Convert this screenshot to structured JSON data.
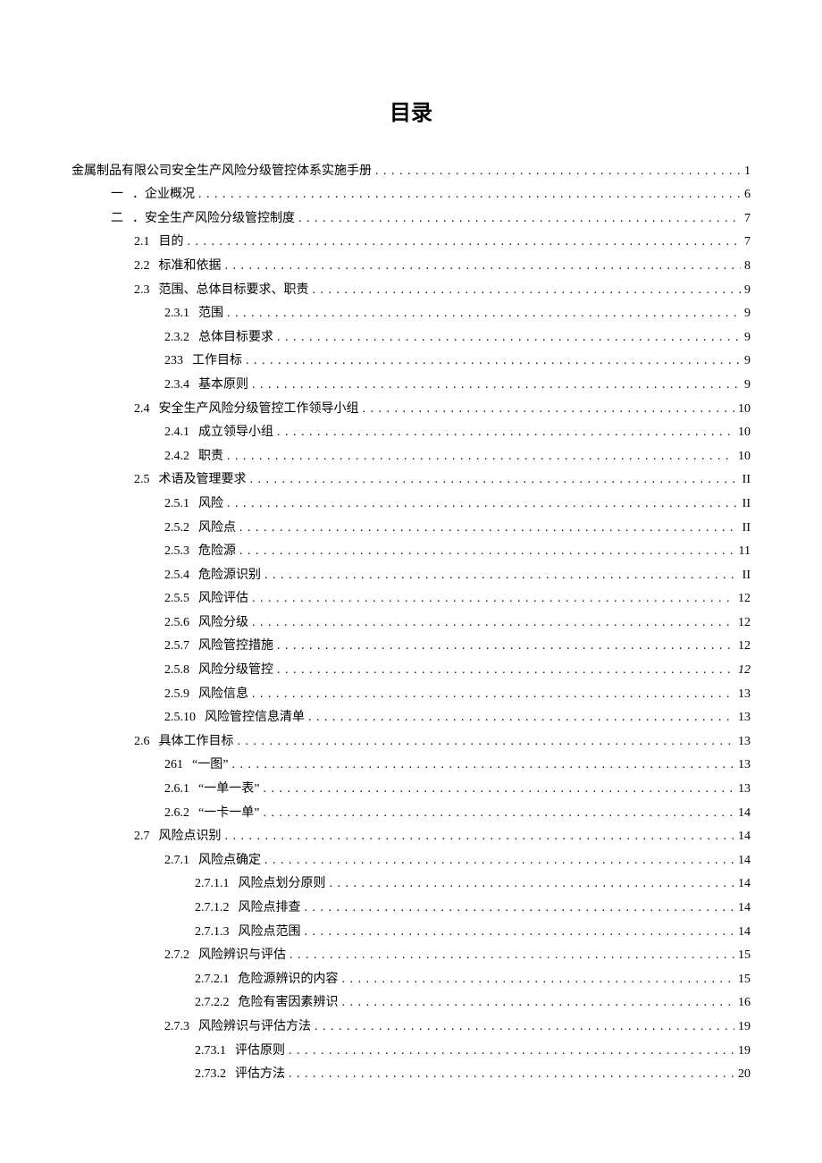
{
  "title": "目录",
  "entries": [
    {
      "level": 0,
      "num": "",
      "label": "金属制品有限公司安全生产风险分级管控体系实施手册",
      "page": "1"
    },
    {
      "level": 1,
      "num": "一",
      "label": "．企业概况",
      "page": "6"
    },
    {
      "level": 1,
      "num": "二",
      "label": "．安全生产风险分级管控制度",
      "page": "7"
    },
    {
      "level": 2,
      "num": "2.1",
      "label": "目的",
      "page": "7"
    },
    {
      "level": 2,
      "num": "2.2",
      "label": "标准和依据",
      "page": "8"
    },
    {
      "level": 2,
      "num": "2.3",
      "label": "范围、总体目标要求、职责",
      "page": "9"
    },
    {
      "level": 3,
      "num": "2.3.1",
      "label": "范围",
      "page": "9"
    },
    {
      "level": 3,
      "num": "2.3.2",
      "label": "总体目标要求",
      "page": "9"
    },
    {
      "level": 3,
      "num": "233",
      "label": "工作目标",
      "page": "9"
    },
    {
      "level": 3,
      "num": "2.3.4",
      "label": "基本原则",
      "page": "9"
    },
    {
      "level": 2,
      "num": "2.4",
      "label": "安全生产风险分级管控工作领导小组",
      "page": "10"
    },
    {
      "level": 3,
      "num": "2.4.1",
      "label": "成立领导小组",
      "page": "10"
    },
    {
      "level": 3,
      "num": "2.4.2",
      "label": "职责",
      "page": "10"
    },
    {
      "level": 2,
      "num": "2.5",
      "label": "术语及管理要求",
      "page": "II"
    },
    {
      "level": 3,
      "num": "2.5.1",
      "label": "风险",
      "page": "II"
    },
    {
      "level": 3,
      "num": "2.5.2",
      "label": "风险点",
      "page": "II"
    },
    {
      "level": 3,
      "num": "2.5.3",
      "label": "危险源",
      "page": "11"
    },
    {
      "level": 3,
      "num": "2.5.4",
      "label": "危险源识别",
      "page": "II"
    },
    {
      "level": 3,
      "num": "2.5.5",
      "label": "风险评估",
      "page": "12"
    },
    {
      "level": 3,
      "num": "2.5.6",
      "label": "风险分级",
      "page": "12"
    },
    {
      "level": 3,
      "num": "2.5.7",
      "label": "风险管控措施",
      "page": "12"
    },
    {
      "level": 3,
      "num": "2.5.8",
      "label": "风险分级管控",
      "page": "12",
      "italic": true
    },
    {
      "level": 3,
      "num": "2.5.9",
      "label": "风险信息",
      "page": "13"
    },
    {
      "level": 3,
      "num": "2.5.10",
      "label": "风险管控信息清单",
      "page": "13"
    },
    {
      "level": 2,
      "num": "2.6",
      "label": "具体工作目标",
      "page": "13"
    },
    {
      "level": 3,
      "num": "261",
      "label": "“一图”",
      "page": "13"
    },
    {
      "level": 3,
      "num": "2.6.1",
      "label": "“一单一表”",
      "page": "13"
    },
    {
      "level": 3,
      "num": "2.6.2",
      "label": "“一卡一单”",
      "page": "14"
    },
    {
      "level": 2,
      "num": "2.7",
      "label": "风险点识别",
      "page": "14"
    },
    {
      "level": 3,
      "num": "2.7.1",
      "label": "风险点确定",
      "page": "14"
    },
    {
      "level": 4,
      "num": "2.7.1.1",
      "label": "风险点划分原则",
      "page": "14"
    },
    {
      "level": 4,
      "num": "2.7.1.2",
      "label": "风险点排查",
      "page": "14"
    },
    {
      "level": 4,
      "num": "2.7.1.3",
      "label": "风险点范围",
      "page": "14"
    },
    {
      "level": 3,
      "num": "2.7.2",
      "label": "风险辨识与评估",
      "page": "15"
    },
    {
      "level": 4,
      "num": "2.7.2.1",
      "label": "危险源辨识的内容",
      "page": "15"
    },
    {
      "level": 4,
      "num": "2.7.2.2",
      "label": "危险有害因素辨识",
      "page": "16"
    },
    {
      "level": 3,
      "num": "2.7.3",
      "label": "风险辨识与评估方法",
      "page": "19"
    },
    {
      "level": 4,
      "num": "2.73.1",
      "label": "评估原则",
      "page": "19"
    },
    {
      "level": 4,
      "num": "2.73.2",
      "label": "评估方法",
      "page": "20"
    }
  ]
}
